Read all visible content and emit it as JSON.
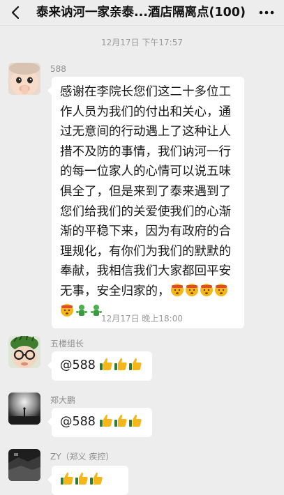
{
  "header": {
    "title": "泰来讷河一家亲泰...酒店隔离点(100)"
  },
  "timestamps": [
    "12月17日 下午17:57",
    "12月17日 晚上18:00"
  ],
  "messages": [
    {
      "sender": "588",
      "text": "感谢在李院长您们这二十多位工作人员为我们的付出和关心，通过无意间的行动遇上了这种让人措不及防的事情，我们讷河一行的每一位家人的心情可以说五味俱全了，但是来到了泰来遇到了您们给我们的关爱使我们的心渐渐的平稳下来，因为有政府的合理规化，有你们为我们的默默的奉献，我相信我们大家都回平安无事，安全归家的，",
      "emojis": [
        "kiss-face-icon",
        "kiss-face-icon",
        "kiss-face-icon",
        "kiss-face-icon",
        "kiss-face-icon",
        "green-figure-icon",
        "green-figure-icon"
      ]
    },
    {
      "sender": "五楼组长",
      "text": "@588",
      "emojis": [
        "thumbs-up-icon",
        "thumbs-up-icon",
        "thumbs-up-icon"
      ]
    },
    {
      "sender": "郑大鹏",
      "text": "@588",
      "emojis": [
        "thumbs-up-icon",
        "thumbs-up-icon",
        "thumbs-up-icon"
      ]
    },
    {
      "sender": "ZY（郑义 疾控）",
      "text": "",
      "emojis": [
        "thumbs-up-icon",
        "thumbs-up-icon",
        "thumbs-up-icon"
      ]
    }
  ],
  "colors": {
    "background": "#ededed",
    "bubble": "#ffffff",
    "timestamp": "#9a9a9a"
  }
}
